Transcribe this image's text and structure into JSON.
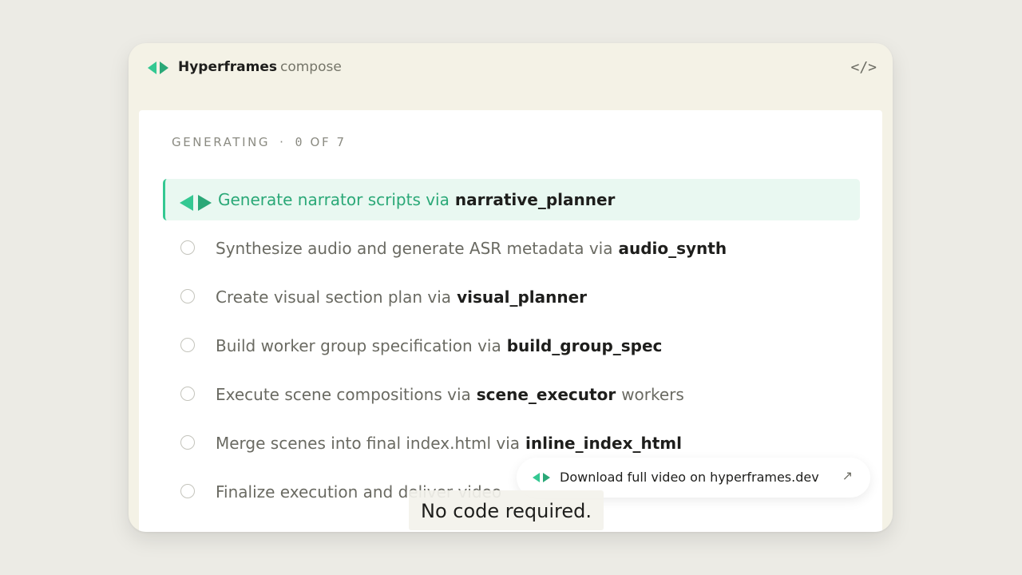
{
  "header": {
    "brand": "Hyperframes",
    "subtitle": "compose",
    "code_icon": "</>",
    "logo_icon": "hyperframes-logo-icon"
  },
  "status": {
    "label": "GENERATING",
    "separator": "·",
    "current": "0",
    "of_label": "OF 7"
  },
  "steps": [
    {
      "text": "Generate narrator scripts via",
      "tool": "narrative_planner",
      "suffix": "",
      "state": "active"
    },
    {
      "text": "Synthesize audio and generate ASR metadata via",
      "tool": "audio_synth",
      "suffix": "",
      "state": "pending"
    },
    {
      "text": "Create visual section plan via",
      "tool": "visual_planner",
      "suffix": "",
      "state": "pending"
    },
    {
      "text": "Build worker group specification via",
      "tool": "build_group_spec",
      "suffix": "",
      "state": "pending"
    },
    {
      "text": "Execute scene compositions via",
      "tool": "scene_executor",
      "suffix": "workers",
      "state": "pending"
    },
    {
      "text": "Merge scenes into final index.html via",
      "tool": "inline_index_html",
      "suffix": "",
      "state": "pending"
    },
    {
      "text": "Finalize execution and deliver video",
      "tool": "",
      "suffix": "",
      "state": "pending"
    }
  ],
  "download": {
    "label": "Download full video on hyperframes.dev",
    "arrow": "↗"
  },
  "caption": {
    "text": "No code required."
  },
  "colors": {
    "accent": "#34c892",
    "accent_text": "#2aa877",
    "active_bg": "#e9f8f1",
    "window_bg": "#f4f2e6",
    "page_bg": "#ecebe5"
  }
}
